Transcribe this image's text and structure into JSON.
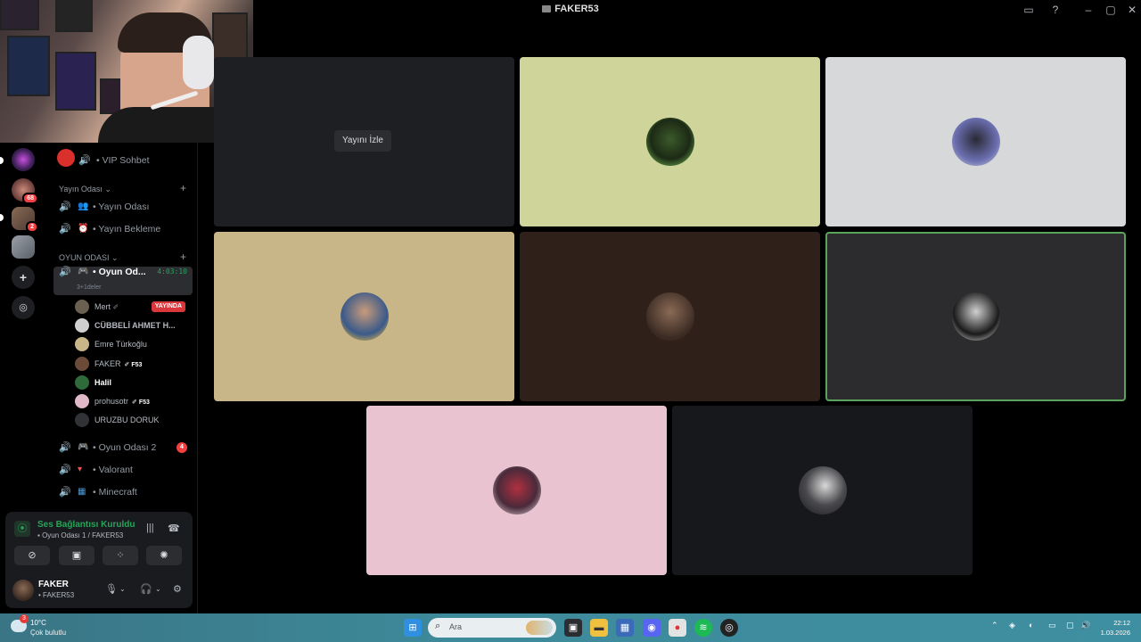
{
  "window": {
    "title": "FAKER53",
    "icons": [
      "inbox-icon",
      "help-icon",
      "minimize-icon",
      "maximize-icon",
      "close-icon"
    ]
  },
  "servers": {
    "badges": [
      "68",
      "2"
    ]
  },
  "channels": {
    "vip": "VIP Sohbet",
    "cat1": "Yayın Odası",
    "yayin_odasi": "Yayın Odası",
    "yayin_bekleme": "Yayın Bekleme",
    "cat2": "OYUN ODASI",
    "active": {
      "label": "Oyun Od...",
      "timer": "4:03:10",
      "note": "3+1deler"
    },
    "members": [
      {
        "name": "Mert",
        "tag": "",
        "live": "YAYINDA"
      },
      {
        "name": "CÜBBELİ AHMET H...",
        "tag": "",
        "live": ""
      },
      {
        "name": "Emre Türkoğlu",
        "tag": "",
        "live": ""
      },
      {
        "name": "FAKER",
        "tag": "F53",
        "live": ""
      },
      {
        "name": "Halil",
        "tag": "",
        "live": ""
      },
      {
        "name": "prohusotr",
        "tag": "F53",
        "live": ""
      },
      {
        "name": "URUZBU DORUK",
        "tag": "",
        "live": ""
      }
    ],
    "oyun2": "Oyun Odası 2",
    "oyun2_badge": "4",
    "valorant": "Valorant",
    "minecraft": "Minecraft"
  },
  "voice": {
    "status": "Ses Bağlantısı Kuruldu",
    "location": "Oyun Odası 1 / FAKER53"
  },
  "user": {
    "name": "FAKER",
    "status": "FAKER53"
  },
  "stage": {
    "watch_button": "Yayını İzle"
  },
  "taskbar": {
    "weather_temp": "10°C",
    "weather_desc": "Çok bulutlu",
    "weather_badge": "3",
    "search_placeholder": "Ara",
    "time": "22:12",
    "date": "1.03.2026"
  },
  "colors": {
    "accent_green": "#23a55a",
    "live_red": "#da373c",
    "tile_lime": "#cfd49a",
    "tile_grey": "#d7d8da",
    "tile_tan": "#c9b688",
    "tile_brown": "#2f211a",
    "tile_dark": "#2c2c2e",
    "tile_pink": "#e9c3cf",
    "tile_black": "#17181b"
  }
}
